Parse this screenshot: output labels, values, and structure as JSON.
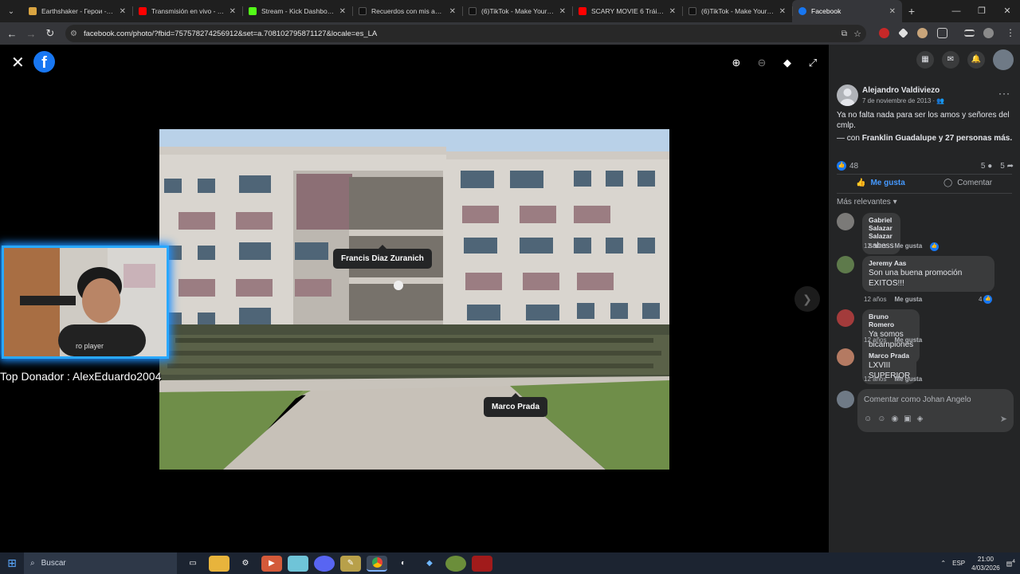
{
  "browser": {
    "tabs": [
      {
        "title": "Earthshaker - Герои - сил",
        "favicon_color": "#d9a441"
      },
      {
        "title": "Transmisión en vivo - You",
        "favicon_color": "#ff0000"
      },
      {
        "title": "Stream - Kick Dashboard",
        "favicon_color": "#53fc18"
      },
      {
        "title": "Recuerdos con mis amigo",
        "favicon_color": "#111111"
      },
      {
        "title": "(6)TikTok - Make Your Day",
        "favicon_color": "#111111"
      },
      {
        "title": "SCARY MOVIE 6 Tráiler Es",
        "favicon_color": "#ff0000"
      },
      {
        "title": "(6)TikTok - Make Your Day",
        "favicon_color": "#111111"
      },
      {
        "title": "Facebook",
        "favicon_color": "#1877f2"
      }
    ],
    "active_tab": "Facebook",
    "url": "facebook.com/photo/?fbid=757578274256912&set=a.708102795871127&locale=es_LA"
  },
  "viewer": {
    "tags": [
      {
        "name": "Francis Diaz Zuranich"
      },
      {
        "name": "Marco Prada"
      }
    ]
  },
  "stream_overlay": {
    "donor_text": "Top Donador : AlexEduardo2004",
    "shirt_text": "ro player"
  },
  "post": {
    "author": "Alejandro Valdiviezo",
    "date": "7 de noviembre de 2013 ·",
    "caption": "Ya no falta nada para ser los amos y señores del cmlp.",
    "with_prefix": "— con ",
    "with_names": "Franklin Guadalupe y 27 personas más.",
    "like_count": "48",
    "comment_count": "5",
    "share_count": "5",
    "like_label": "Me gusta",
    "comment_label": "Comentar",
    "sort_label": "Más relevantes"
  },
  "comments": [
    {
      "name": "Gabriel Salazar Salazar",
      "text": "sabess",
      "age": "12 años",
      "like": "Me gusta",
      "reactions": "",
      "avatar_color": "#7b7a78"
    },
    {
      "name": "Jeremy Aas",
      "text": "Son una buena promoción EXITOS!!!",
      "age": "12 años",
      "like": "Me gusta",
      "reactions": "4",
      "avatar_color": "#5e7a4b"
    },
    {
      "name": "Bruno Romero",
      "text": "Ya somos bicampiones 🙂",
      "age": "12 años",
      "like": "Me gusta",
      "reactions": "",
      "avatar_color": "#a33b3b"
    },
    {
      "name": "Marco Prada",
      "text": "LXVIII SUPERIOR",
      "age": "12 años",
      "like": "Me gusta",
      "reactions": "",
      "avatar_color": "#b47a62"
    }
  ],
  "composer": {
    "placeholder": "Comentar como Johan Angelo"
  },
  "taskbar": {
    "search_label": "Buscar",
    "lang": "ESP",
    "time": "21:00",
    "date": "4/03/2026",
    "notif_count": "4"
  }
}
